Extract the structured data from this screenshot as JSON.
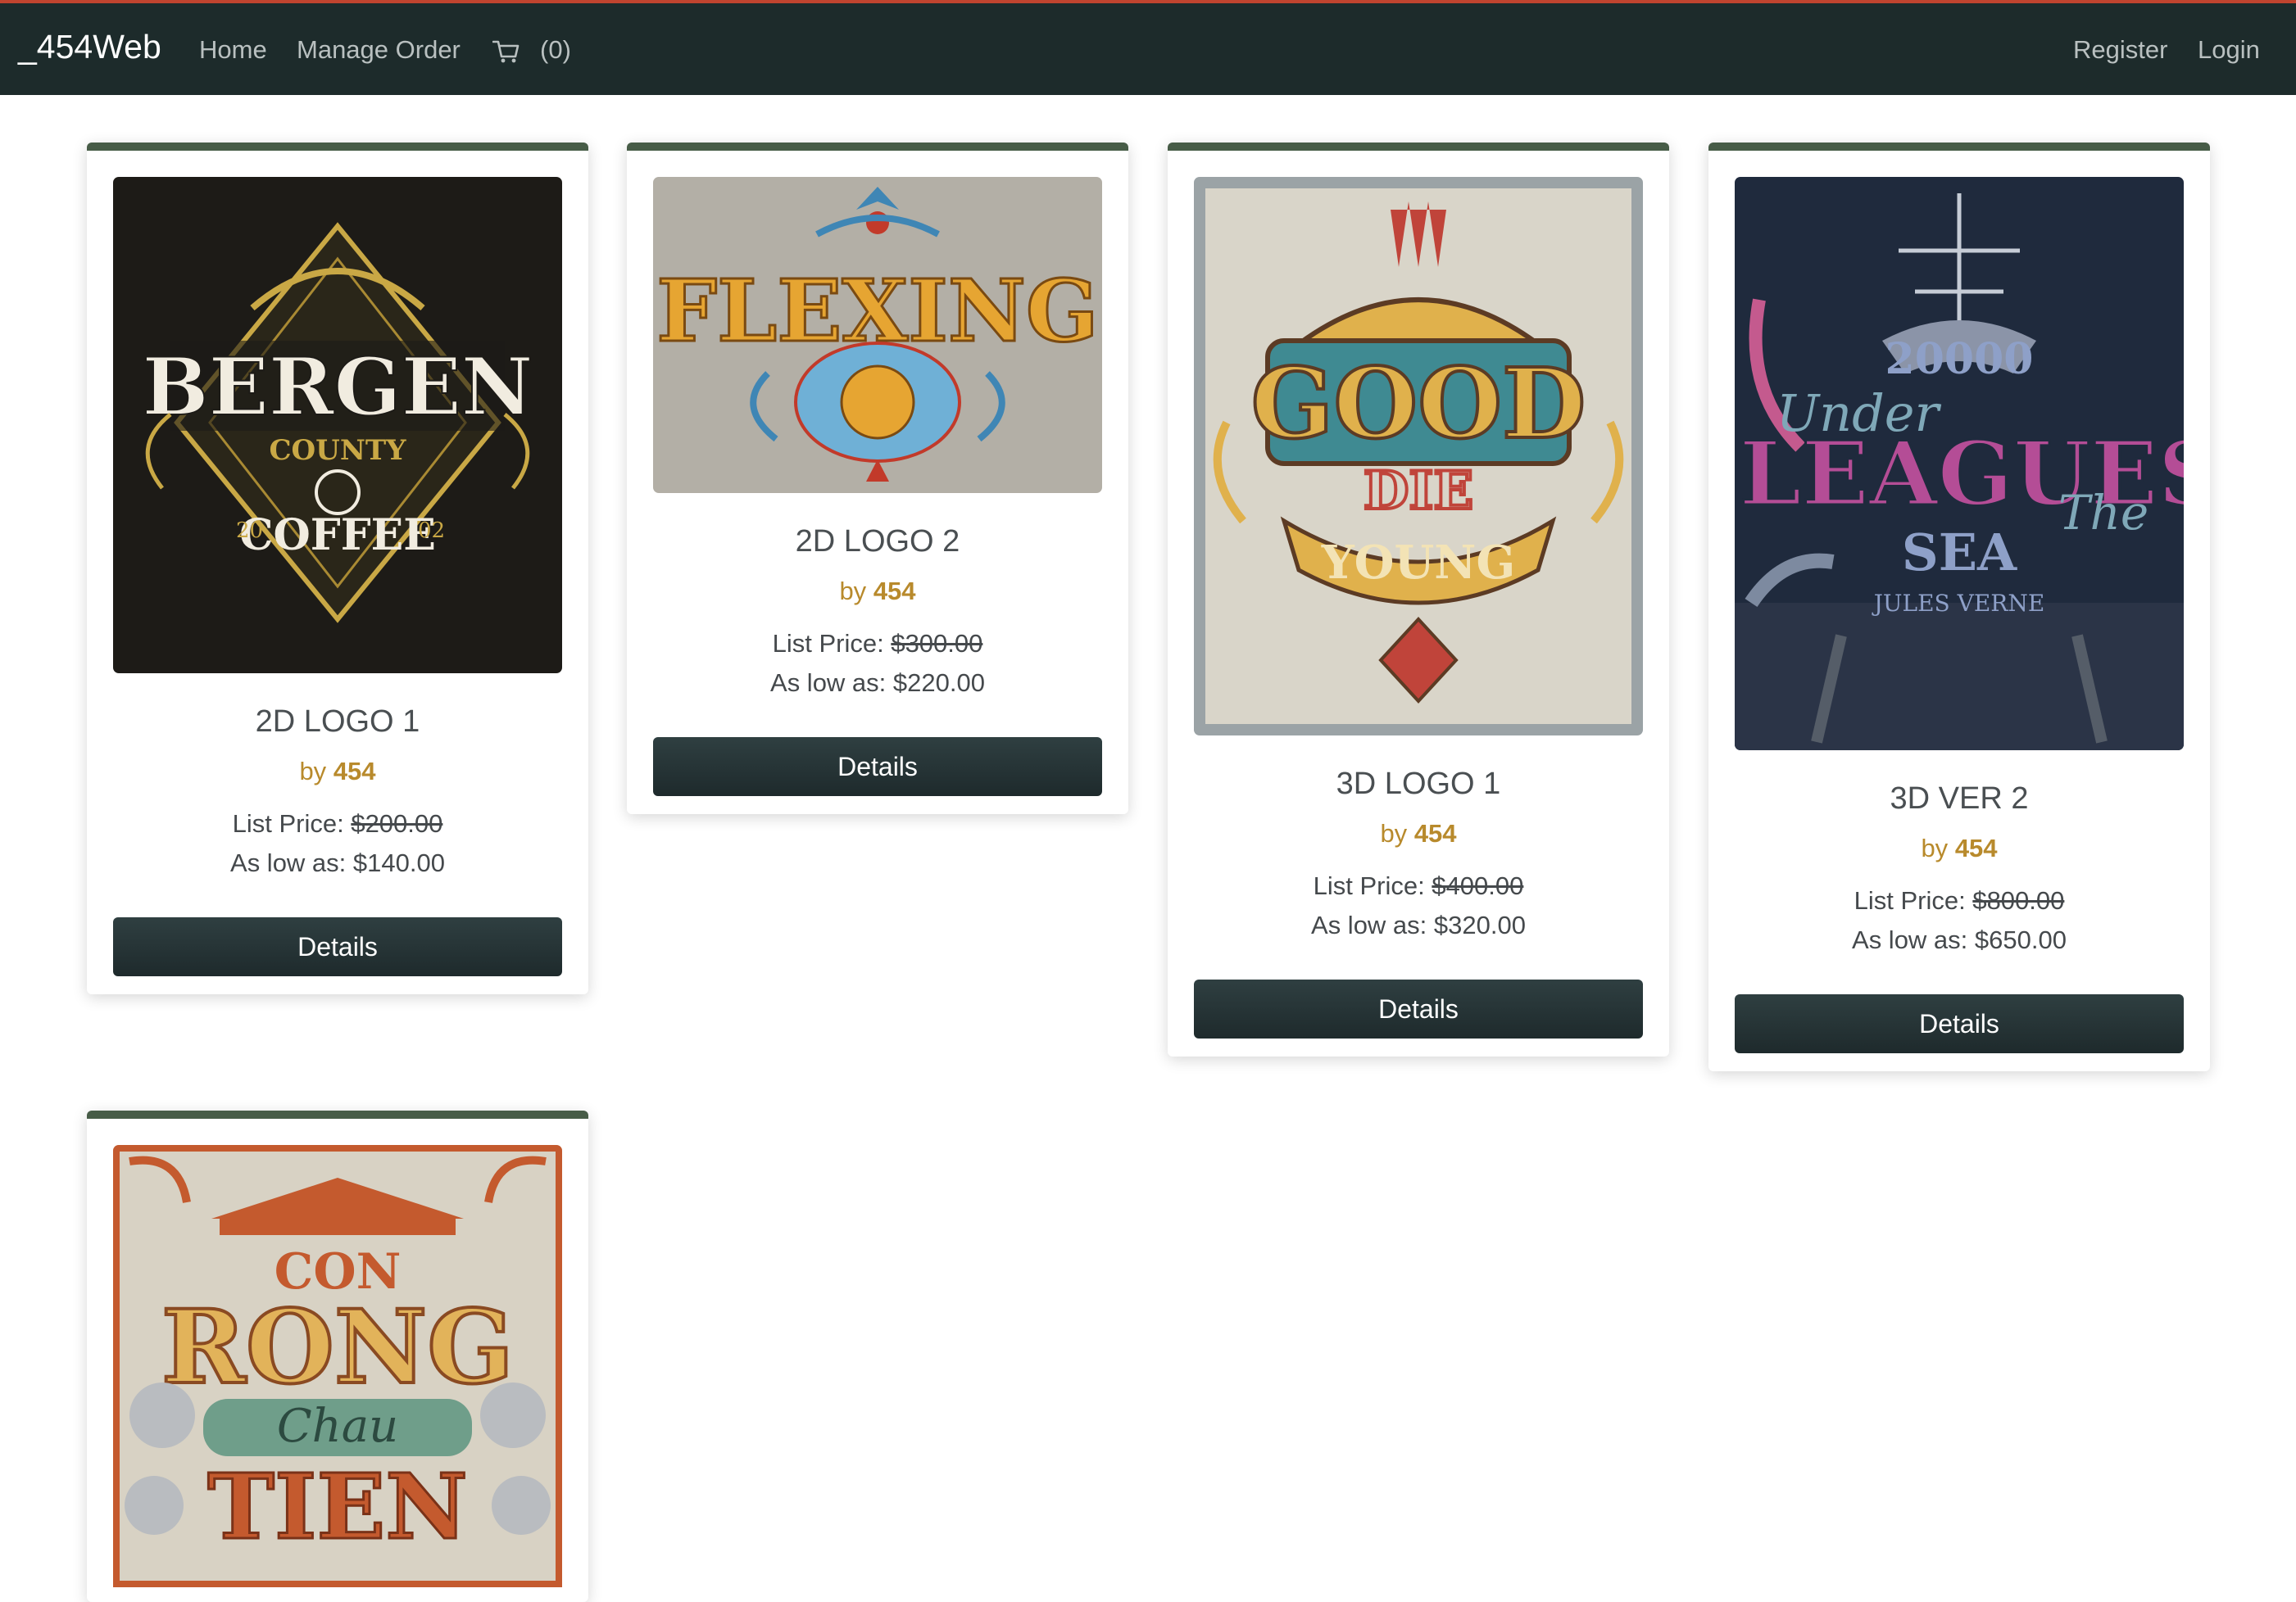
{
  "navbar": {
    "brand": "_454Web",
    "links": [
      "Home",
      "Manage Order"
    ],
    "cart_count": "(0)",
    "auth_links": [
      "Register",
      "Login"
    ]
  },
  "products": [
    {
      "title": "2D LOGO 1",
      "by": "by",
      "author": "454",
      "list_label": "List Price:",
      "list_price": "$200.00",
      "low_label": "As low as:",
      "low_price": "$140.00",
      "button": "Details",
      "image_text": "BERGEN COUNTY COFFEE"
    },
    {
      "title": "2D LOGO 2",
      "by": "by",
      "author": "454",
      "list_label": "List Price:",
      "list_price": "$300.00",
      "low_label": "As low as:",
      "low_price": "$220.00",
      "button": "Details",
      "image_text": "FLEXING"
    },
    {
      "title": "3D LOGO 1",
      "by": "by",
      "author": "454",
      "list_label": "List Price:",
      "list_price": "$400.00",
      "low_label": "As low as:",
      "low_price": "$320.00",
      "button": "Details",
      "image_text": "THE GOOD DIE YOUNG"
    },
    {
      "title": "3D VER 2",
      "by": "by",
      "author": "454",
      "list_label": "List Price:",
      "list_price": "$800.00",
      "low_label": "As low as:",
      "low_price": "$650.00",
      "button": "Details",
      "image_text": "20000 LEAGUES UNDER THE SEA"
    },
    {
      "title": "",
      "by": "",
      "author": "",
      "list_label": "",
      "list_price": "",
      "low_label": "",
      "low_price": "",
      "button": "",
      "image_text": "CON RONG CHAU TIEN"
    }
  ],
  "colors": {
    "navbar_bg": "#1d2b2b",
    "navbar_top_border": "#c0442f",
    "card_top_border": "#475c47",
    "author_color": "#b88a2c",
    "button_bg": "#1e2a2c"
  },
  "icons": {
    "cart": "cart-icon"
  }
}
